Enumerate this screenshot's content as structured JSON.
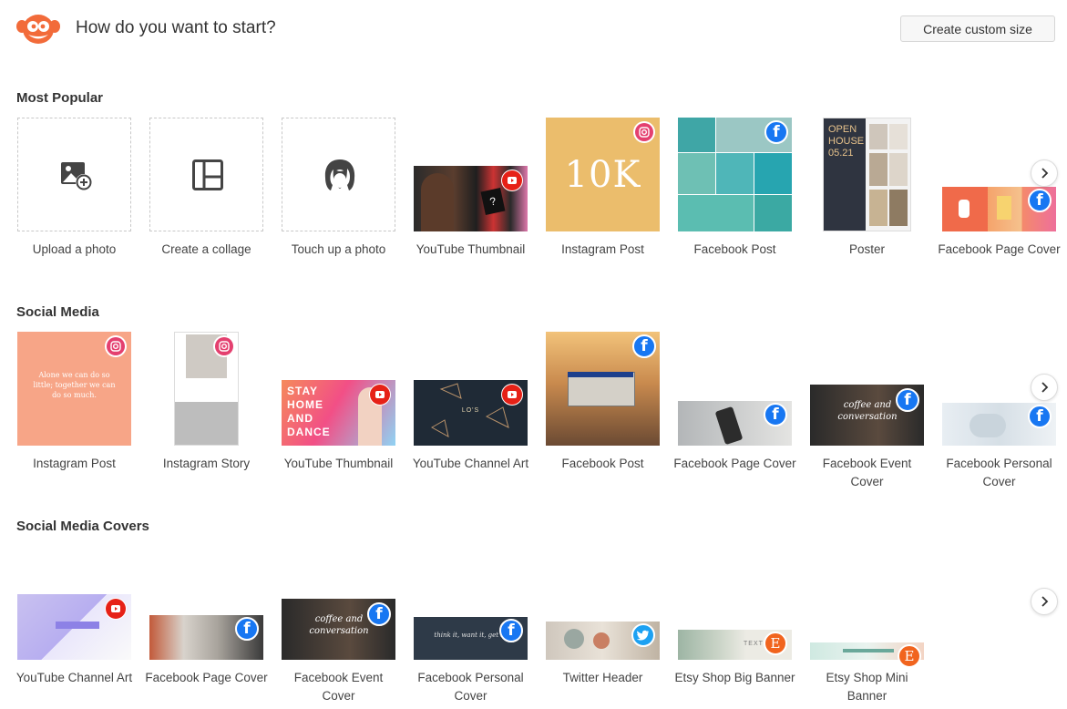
{
  "header": {
    "title": "How do you want to start?",
    "custom_size_label": "Create custom size",
    "logo_icon": "picmonkey-logo-icon",
    "brand_color": "#f26b3a"
  },
  "sections": [
    {
      "title": "Most Popular",
      "items": [
        {
          "label": "Upload a photo",
          "icon": "upload-photo-icon"
        },
        {
          "label": "Create a collage",
          "icon": "collage-icon"
        },
        {
          "label": "Touch up a photo",
          "icon": "face-icon"
        },
        {
          "label": "YouTube Thumbnail",
          "badge": "youtube-icon"
        },
        {
          "label": "Instagram Post",
          "badge": "instagram-icon",
          "thumb_text": "10K"
        },
        {
          "label": "Facebook Post",
          "badge": "facebook-icon"
        },
        {
          "label": "Poster",
          "thumb_text": "OPEN HOUSE 05.21"
        },
        {
          "label": "Facebook Page Cover",
          "badge": "facebook-icon"
        }
      ]
    },
    {
      "title": "Social Media",
      "items": [
        {
          "label": "Instagram Post",
          "badge": "instagram-icon",
          "thumb_text": "Alone we can do so little; together we can do so much."
        },
        {
          "label": "Instagram Story",
          "badge": "instagram-icon"
        },
        {
          "label": "YouTube Thumbnail",
          "badge": "youtube-icon",
          "thumb_text": "STAY HOME AND DANCE"
        },
        {
          "label": "YouTube Channel Art",
          "badge": "youtube-icon",
          "thumb_text": "LO'S"
        },
        {
          "label": "Facebook Post",
          "badge": "facebook-icon"
        },
        {
          "label": "Facebook Page Cover",
          "badge": "facebook-icon"
        },
        {
          "label": "Facebook Event Cover",
          "badge": "facebook-icon",
          "thumb_text": "coffee and conversation"
        },
        {
          "label": "Facebook Personal Cover",
          "badge": "facebook-icon"
        }
      ]
    },
    {
      "title": "Social Media Covers",
      "items": [
        {
          "label": "YouTube Channel Art",
          "badge": "youtube-icon"
        },
        {
          "label": "Facebook Page Cover",
          "badge": "facebook-icon"
        },
        {
          "label": "Facebook Event Cover",
          "badge": "facebook-icon",
          "thumb_text": "coffee and conversation"
        },
        {
          "label": "Facebook Personal Cover",
          "badge": "facebook-icon",
          "thumb_text": "think it, want it, get it."
        },
        {
          "label": "Twitter Header",
          "badge": "twitter-icon"
        },
        {
          "label": "Etsy Shop Big Banner",
          "badge": "etsy-icon",
          "badge_letter": "E",
          "thumb_text": "TEXTILES"
        },
        {
          "label": "Etsy Shop Mini Banner",
          "badge": "etsy-icon",
          "badge_letter": "E"
        }
      ]
    }
  ],
  "next_icon": "chevron-right-icon",
  "colors": {
    "facebook": "#1877f2",
    "instagram": "#e4406f",
    "youtube": "#e62117",
    "twitter": "#1da1f2",
    "etsy": "#f1641e"
  }
}
